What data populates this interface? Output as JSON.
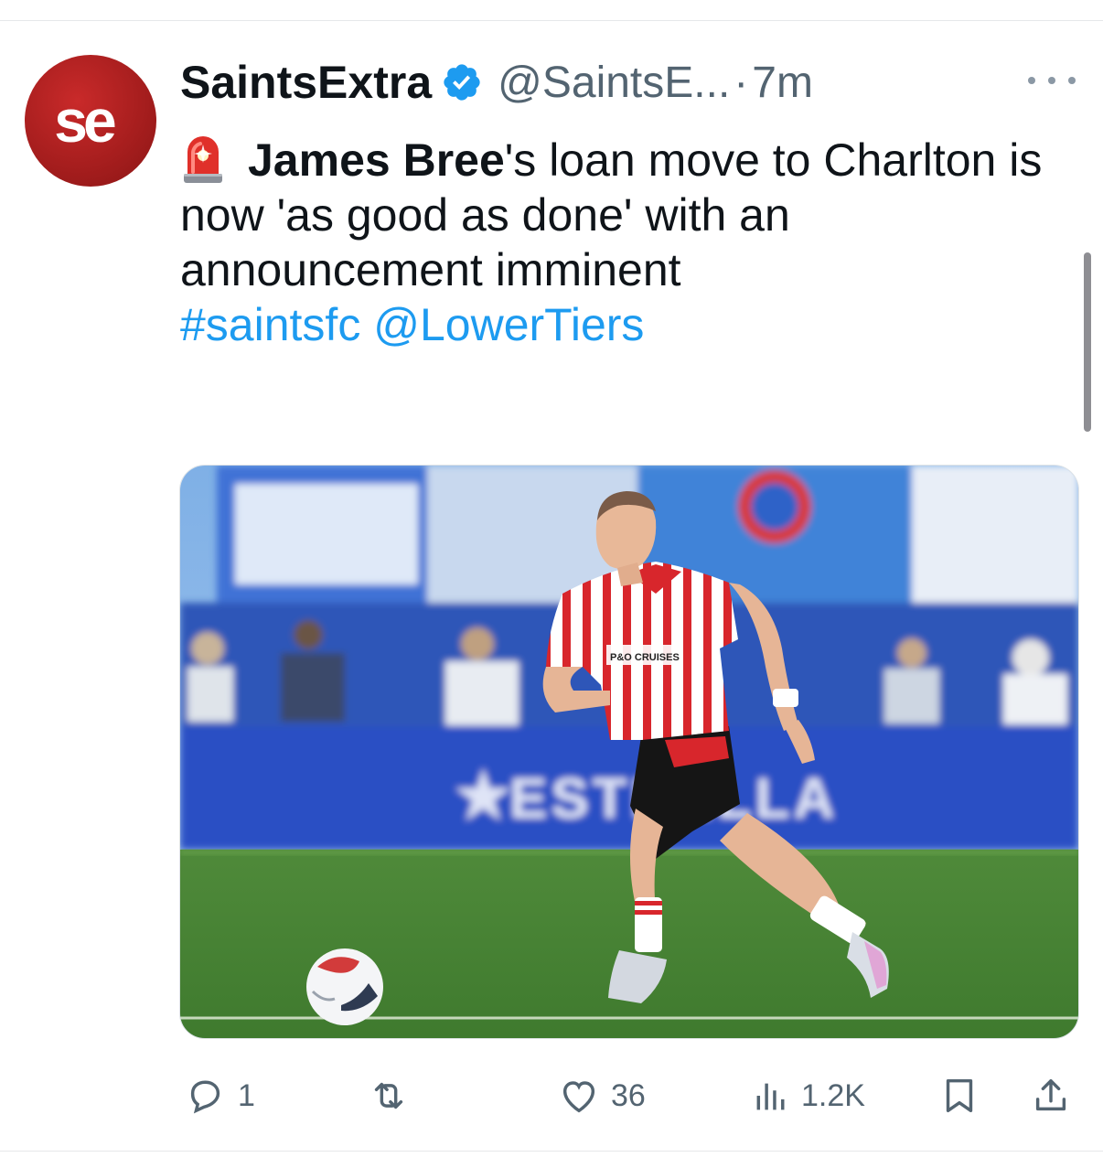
{
  "tweet": {
    "avatar_text": "se",
    "display_name": "SaintsExtra",
    "handle": "@SaintsE...",
    "separator": "·",
    "time": "7m",
    "text": {
      "name_bold": "James Bree",
      "body": "'s loan move to Charlton is now 'as good as done' with an announcement imminent",
      "hashtag": "#saintsfc",
      "mention": "@LowerTiers"
    },
    "media": {
      "shirt_sponsor": "P&O CRUISES",
      "board_text": "ESTRELLA"
    },
    "actions": {
      "replies": "1",
      "retweets": "",
      "likes": "36",
      "views": "1.2K"
    }
  },
  "icons": [
    "verified-badge-icon",
    "siren-emoji-icon",
    "more-icon",
    "reply-icon",
    "retweet-icon",
    "like-icon",
    "views-icon",
    "bookmark-icon",
    "share-icon"
  ],
  "colors": {
    "link": "#1d9bf0",
    "verified": "#1d9bf0",
    "secondary_text": "#536471",
    "avatar_red": "#a41d1d"
  }
}
